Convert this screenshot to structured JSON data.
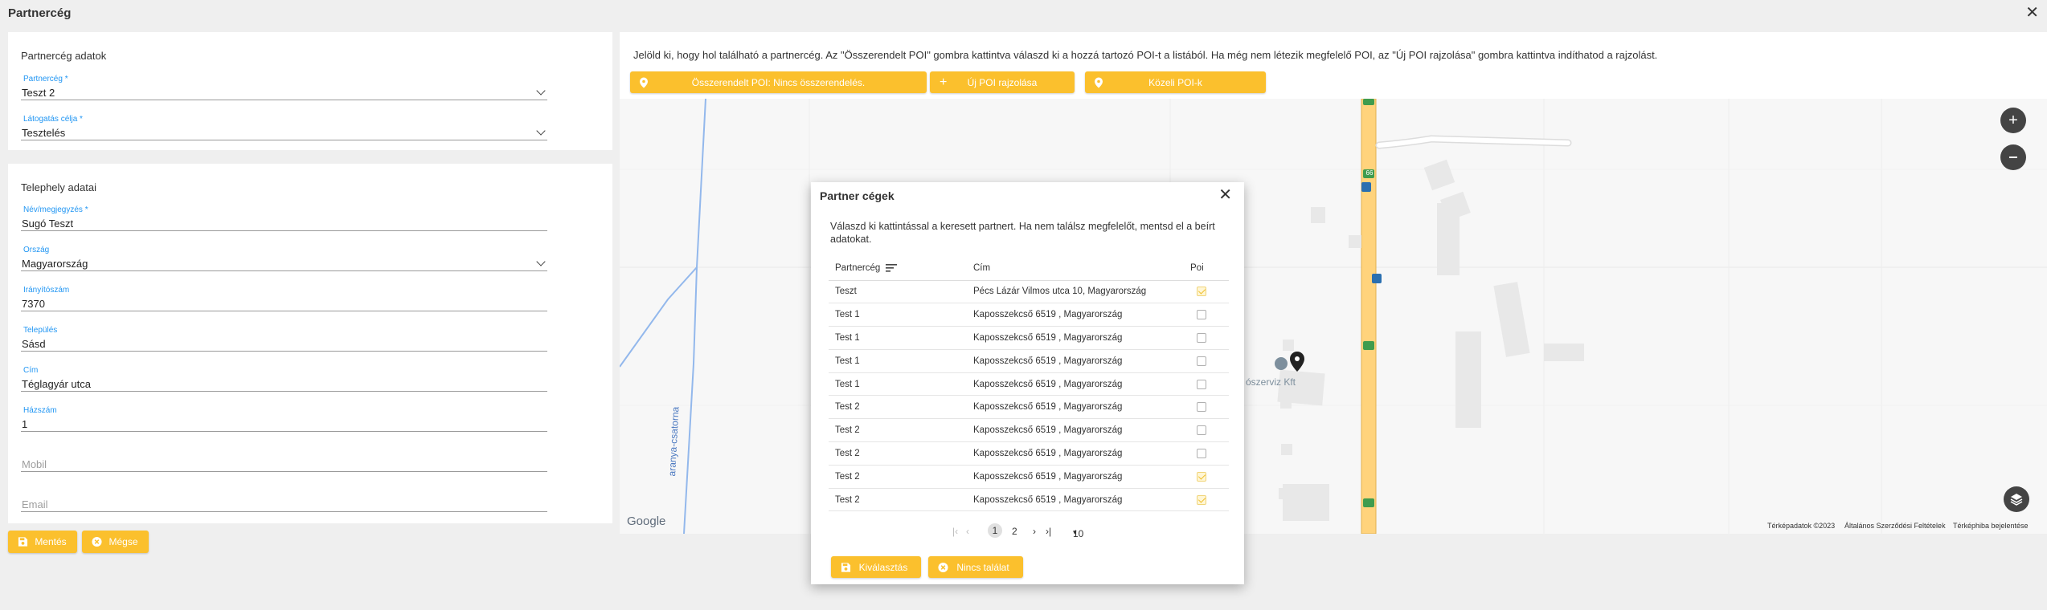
{
  "window": {
    "title": "Partnercég"
  },
  "partner_panel": {
    "title": "Partnercég adatok",
    "partner_label": "Partnercég *",
    "partner_value": "Teszt 2",
    "visit_label": "Látogatás célja *",
    "visit_value": "Tesztelés"
  },
  "site_panel": {
    "title": "Telephely adatai",
    "name_label": "Név/megjegyzés *",
    "name_value": "Sugó Teszt",
    "country_label": "Ország",
    "country_value": "Magyarország",
    "zip_label": "Irányítószám",
    "zip_value": "7370",
    "city_label": "Település",
    "city_value": "Sásd",
    "address_label": "Cím",
    "address_value": "Téglagyár utca",
    "house_label": "Házszám",
    "house_value": "1",
    "mobile_placeholder": "Mobil",
    "email_placeholder": "Email"
  },
  "footer": {
    "save_label": "Mentés",
    "cancel_label": "Mégse"
  },
  "map_info": {
    "text": "Jelöld ki, hogy hol található a partnercég. Az \"Összerendelt POI\" gombra kattintva válaszd ki a hozzá tartozó POI-t a listából. Ha még nem létezik megfelelő POI, az \"Új POI rajzolása\" gombra kattintva indíthatod a rajzolást.",
    "assigned_poi_label": "Összerendelt POI: Nincs összerendelés.",
    "new_poi_label": "Új POI rajzolása",
    "nearby_poi_label": "Közeli POI-k"
  },
  "map": {
    "canal_label": "aranya-csatorna",
    "place_label": "ószerviz Kft",
    "road_number": "66",
    "google_label": "Google",
    "attr_data": "Térképadatok ©2023",
    "attr_terms": "Általános Szerződési Feltételek",
    "attr_report": "Térképhiba bejelentése"
  },
  "dialog": {
    "title": "Partner cégek",
    "description": "Válaszd ki kattintással a keresett partnert. Ha nem találsz megfelelőt, mentsd el a beírt adatokat.",
    "columns": {
      "partner": "Partnercég",
      "address": "Cím",
      "poi": "Poi"
    },
    "rows": [
      {
        "partner": "Teszt",
        "address": "Pécs Lázár Vilmos utca 10, Magyarország",
        "poi": true
      },
      {
        "partner": "Test 1",
        "address": "Kaposszekcső 6519 , Magyarország",
        "poi": false
      },
      {
        "partner": "Test 1",
        "address": "Kaposszekcső 6519 , Magyarország",
        "poi": false
      },
      {
        "partner": "Test 1",
        "address": "Kaposszekcső 6519 , Magyarország",
        "poi": false
      },
      {
        "partner": "Test 1",
        "address": "Kaposszekcső 6519 , Magyarország",
        "poi": false
      },
      {
        "partner": "Test 2",
        "address": "Kaposszekcső 6519 , Magyarország",
        "poi": false
      },
      {
        "partner": "Test 2",
        "address": "Kaposszekcső 6519 , Magyarország",
        "poi": false
      },
      {
        "partner": "Test 2",
        "address": "Kaposszekcső 6519 , Magyarország",
        "poi": false
      },
      {
        "partner": "Test 2",
        "address": "Kaposszekcső 6519 , Magyarország",
        "poi": true
      },
      {
        "partner": "Test 2",
        "address": "Kaposszekcső 6519 , Magyarország",
        "poi": true
      }
    ],
    "pager": {
      "page1": "1",
      "page2": "2",
      "page_size": "10"
    },
    "select_label": "Kiválasztás",
    "none_label": "Nincs találat"
  },
  "colors": {
    "accent": "#fbc02d",
    "label_blue": "#2196f3"
  }
}
